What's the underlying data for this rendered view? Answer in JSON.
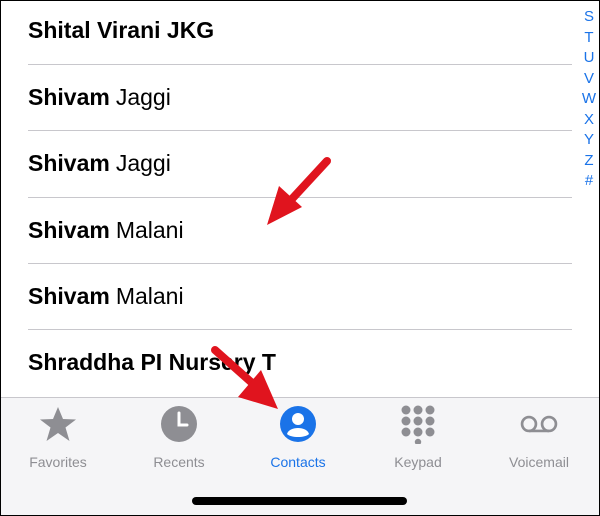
{
  "contacts": [
    {
      "first": "Shital Virani JKG",
      "last": ""
    },
    {
      "first": "Shivam",
      "last": "Jaggi"
    },
    {
      "first": "Shivam",
      "last": "Jaggi"
    },
    {
      "first": "Shivam",
      "last": "Malani"
    },
    {
      "first": "Shivam",
      "last": "Malani"
    },
    {
      "first": "Shraddha PI Nursery T",
      "last": ""
    }
  ],
  "index_letters": [
    "S",
    "T",
    "U",
    "V",
    "W",
    "X",
    "Y",
    "Z",
    "#"
  ],
  "tabs": [
    {
      "label": "Favorites",
      "icon": "star-icon",
      "active": false
    },
    {
      "label": "Recents",
      "icon": "clock-icon",
      "active": false
    },
    {
      "label": "Contacts",
      "icon": "person-circle-icon",
      "active": true
    },
    {
      "label": "Keypad",
      "icon": "keypad-icon",
      "active": false
    },
    {
      "label": "Voicemail",
      "icon": "voicemail-icon",
      "active": false
    }
  ],
  "colors": {
    "accent": "#1a73e8",
    "inactive": "#8e8e93",
    "annotation_arrow": "#e0141e"
  }
}
